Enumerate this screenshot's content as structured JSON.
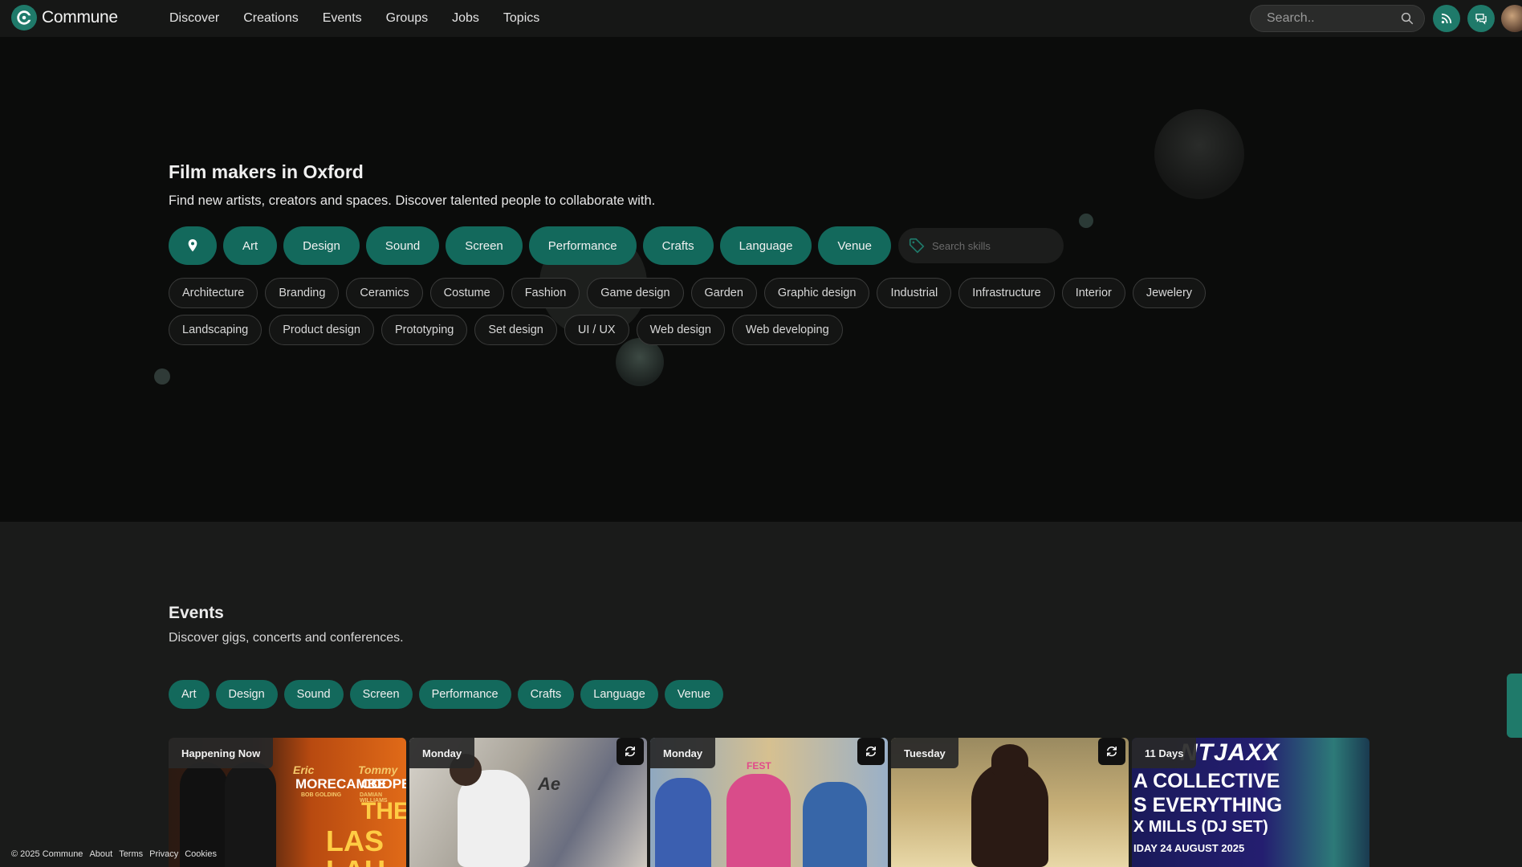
{
  "app": {
    "name": "Commune"
  },
  "nav": {
    "items": [
      "Discover",
      "Creations",
      "Events",
      "Groups",
      "Jobs",
      "Topics"
    ]
  },
  "search": {
    "placeholder": "Search.."
  },
  "hero": {
    "title": "Film makers in Oxford",
    "subtitle": "Find new artists, creators and spaces. Discover talented people to collaborate with.",
    "categories": [
      "Art",
      "Design",
      "Sound",
      "Screen",
      "Performance",
      "Crafts",
      "Language",
      "Venue"
    ],
    "skill_search_placeholder": "Search skills",
    "skills": [
      "Architecture",
      "Branding",
      "Ceramics",
      "Costume",
      "Fashion",
      "Game design",
      "Garden",
      "Graphic design",
      "Industrial",
      "Infrastructure",
      "Interior",
      "Jewelery",
      "Landscaping",
      "Product design",
      "Prototyping",
      "Set design",
      "UI / UX",
      "Web design",
      "Web developing"
    ]
  },
  "events": {
    "title": "Events",
    "subtitle": "Discover gigs, concerts and conferences.",
    "categories": [
      "Art",
      "Design",
      "Sound",
      "Screen",
      "Performance",
      "Crafts",
      "Language",
      "Venue"
    ],
    "cards": [
      {
        "badge": "Happening Now",
        "recurring": false,
        "art": [
          "Eric",
          "MORECAMBE",
          "Tommy",
          "COOPER",
          "BOB GOLDING",
          "DAMIAN WILLIAMS",
          "THE",
          "LAS",
          "LAU"
        ]
      },
      {
        "badge": "Monday",
        "recurring": true,
        "art": [
          "Ae"
        ]
      },
      {
        "badge": "Monday",
        "recurring": true,
        "art": [
          "FEST"
        ]
      },
      {
        "badge": "Tuesday",
        "recurring": true,
        "art": []
      },
      {
        "badge": "11 Days",
        "recurring": false,
        "art": [
          "NTJAXX",
          "A COLLECTIVE",
          "S EVERYTHING",
          "X MILLS (DJ SET)",
          "IDAY 24 AUGUST 2025"
        ]
      }
    ]
  },
  "footer": {
    "copyright": "© 2025 Commune",
    "links": [
      "About",
      "Terms",
      "Privacy",
      "Cookies"
    ]
  },
  "colors": {
    "accent": "#1f7a6a",
    "pill": "#13695c",
    "background": "#0b0c0b",
    "panel": "#1a1b1a"
  },
  "icons": {
    "logo": "commune-c-icon",
    "search": "search-icon",
    "feed": "rss-icon",
    "messages": "chat-icon",
    "location": "map-pin-icon",
    "tag": "tag-icon",
    "recurring": "repeat-icon"
  }
}
